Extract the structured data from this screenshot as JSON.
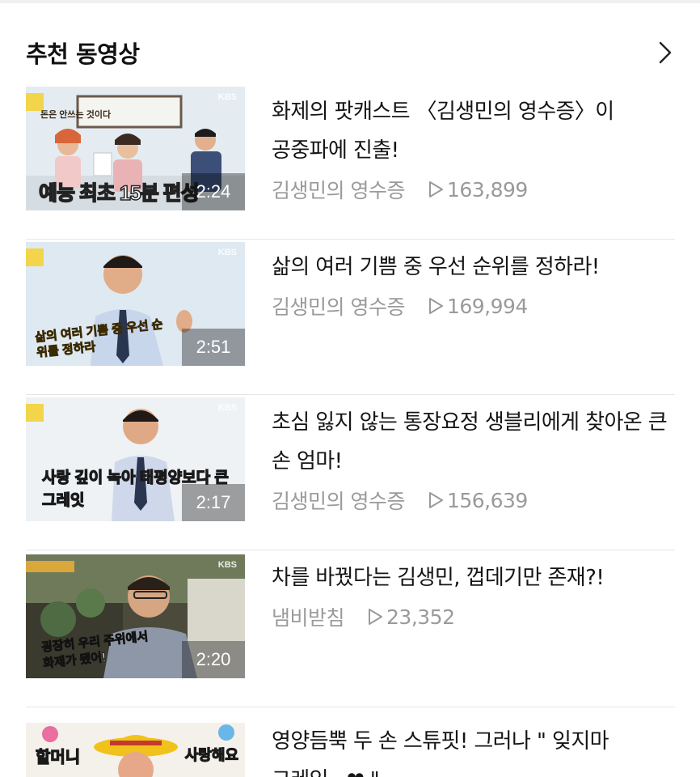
{
  "section": {
    "title": "추천 동영상"
  },
  "videos": [
    {
      "title": "화제의 팟캐스트 〈김생민의 영수증〉이 공중파에 진출!",
      "channel": "김생민의 영수증",
      "views": "163,899",
      "duration": "2:24",
      "broadcaster": "KBS",
      "thumb_caption": "예능 최초 15분 편성",
      "thumb_sign": "돈은 안쓰는 것이다"
    },
    {
      "title": "삶의 여러 기쁨 중 우선 순위를 정하라!",
      "channel": "김생민의 영수증",
      "views": "169,994",
      "duration": "2:51",
      "broadcaster": "KBS",
      "thumb_caption": "삶의 여러 기쁨 중 우선 순위를 정하라"
    },
    {
      "title": "초심 잃지 않는 통장요정 생블리에게 찾아온 큰 손 엄마!",
      "channel": "김생민의 영수증",
      "views": "156,639",
      "duration": "2:17",
      "broadcaster": "KBS",
      "thumb_caption": "사랑 깊이 녹아 태평양보다 큰 그레잇"
    },
    {
      "title": "차를 바꿨다는 김생민, 껍데기만 존재?!",
      "channel": "냄비받침",
      "views": "23,352",
      "duration": "2:20",
      "broadcaster": "KBS",
      "thumb_caption": "굉장히 우리 주위에서 화제가 됐어!"
    },
    {
      "title": "영양듬뿍 두 손 스튜핏! 그러나 \" 잊지마 그레잇...❤ \"",
      "thumb_caption_left": "할머니",
      "thumb_caption_right": "사랑해요"
    }
  ],
  "colors": {
    "title_text": "#151515",
    "meta_text": "#9a9a9a",
    "divider": "#e6e6e6"
  }
}
